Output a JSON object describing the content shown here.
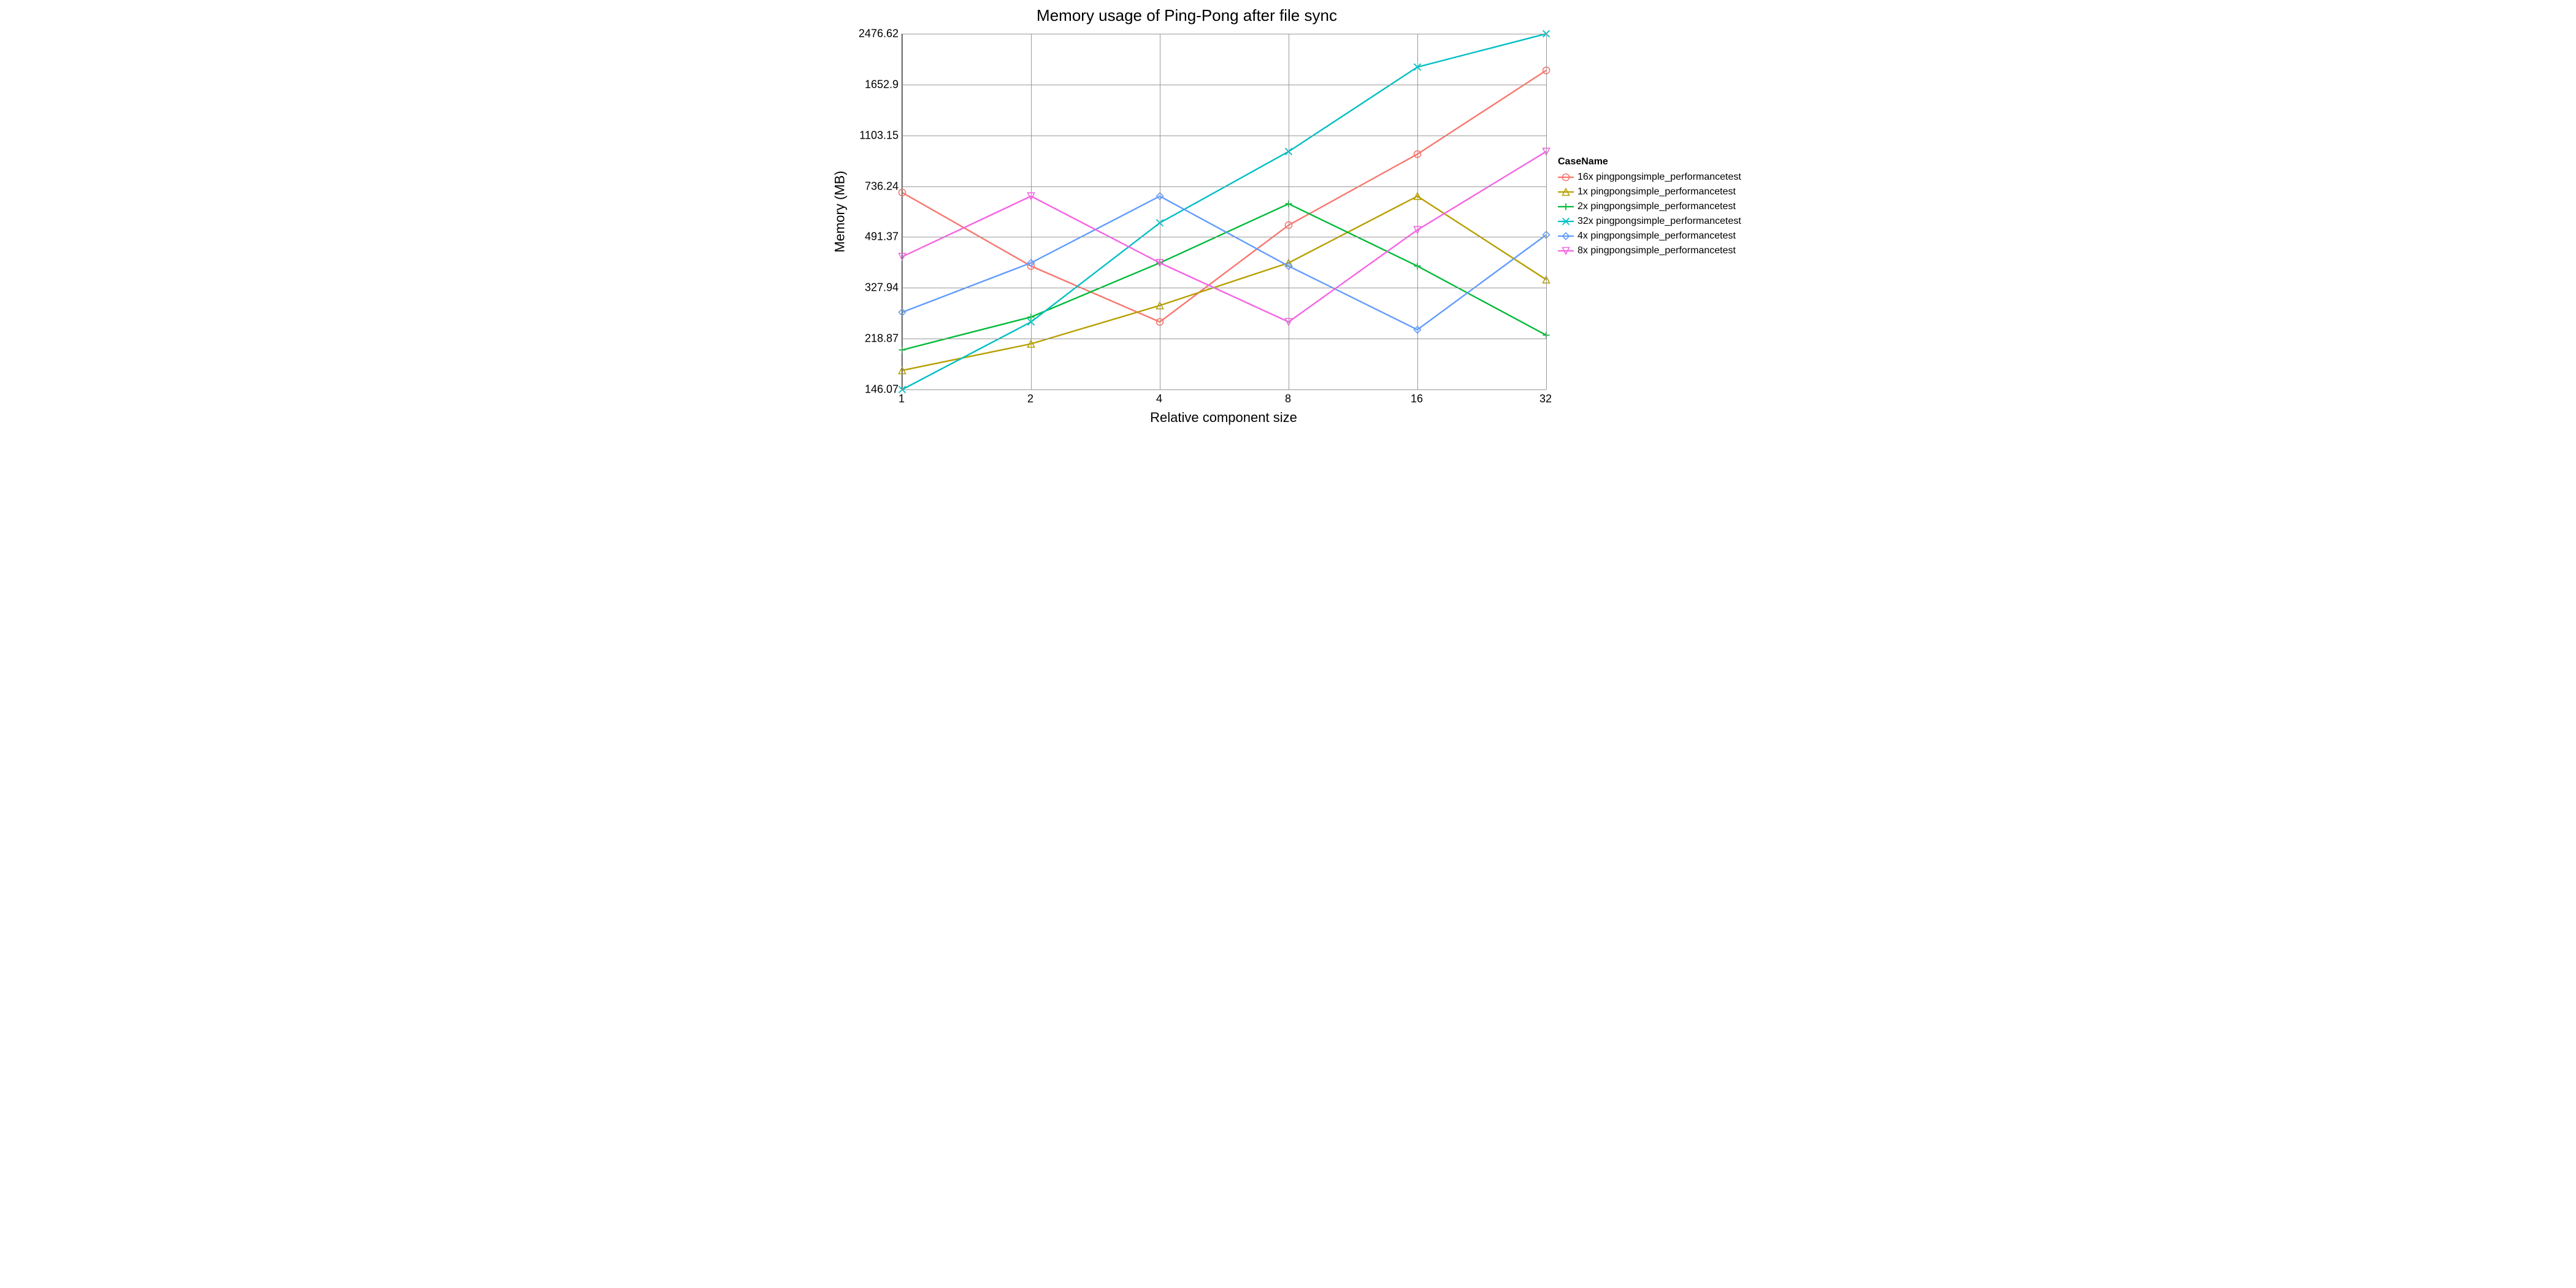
{
  "chart_data": {
    "type": "line",
    "title": "Memory usage of Ping-Pong after file sync",
    "xlabel": "Relative component size",
    "ylabel": "Memory (MB)",
    "x_categories": [
      1,
      2,
      4,
      8,
      16,
      32
    ],
    "y_ticks": [
      146.07,
      218.87,
      327.94,
      491.37,
      736.24,
      1103.15,
      1652.9,
      2476.62
    ],
    "y_scale": "log",
    "x_scale": "log",
    "legend_title": "CaseName",
    "series": [
      {
        "name": "16x pingpongsimple_performancetest",
        "color": "#f8766d",
        "marker": "circle-open",
        "values": [
          700,
          390,
          250,
          540,
          950,
          1850
        ]
      },
      {
        "name": "1x pingpongsimple_performancetest",
        "color": "#b79f00",
        "marker": "triangle-up-open",
        "values": [
          170,
          210,
          285,
          400,
          680,
          350
        ]
      },
      {
        "name": "2x pingpongsimple_performancetest",
        "color": "#00ba38",
        "marker": "plus",
        "values": [
          200,
          260,
          400,
          640,
          390,
          225
        ]
      },
      {
        "name": "32x pingpongsimple_performancetest",
        "color": "#00bfc4",
        "marker": "x",
        "values": [
          146,
          250,
          550,
          970,
          1900,
          2476
        ]
      },
      {
        "name": "4x pingpongsimple_performancetest",
        "color": "#619cff",
        "marker": "diamond-open",
        "values": [
          270,
          400,
          680,
          390,
          235,
          500
        ]
      },
      {
        "name": "8x pingpongsimple_performancetest",
        "color": "#f564e3",
        "marker": "triangle-down-open",
        "values": [
          420,
          680,
          400,
          250,
          520,
          970
        ]
      }
    ]
  }
}
